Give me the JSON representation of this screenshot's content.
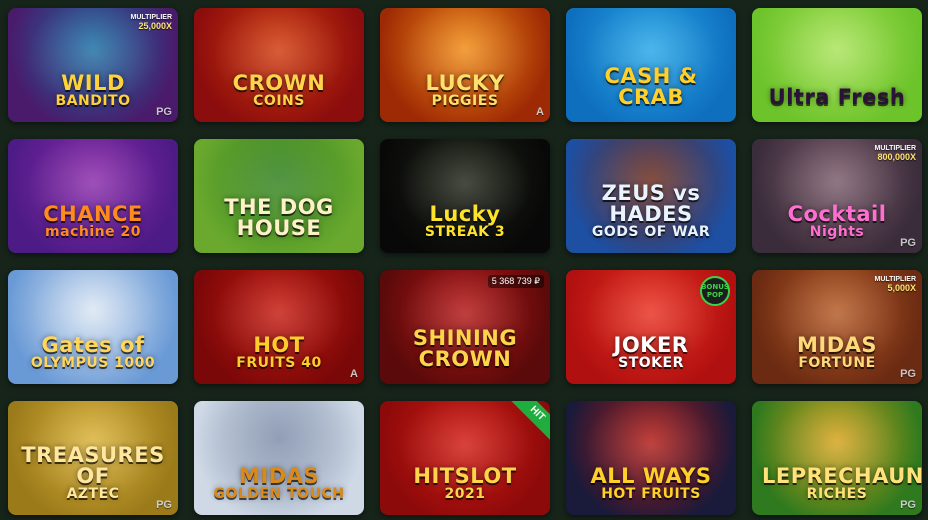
{
  "games": [
    {
      "id": "wild-bandito",
      "title": "WILD",
      "sub": "BANDITO",
      "provider": "PG",
      "multiplier": "MULTIPLIER",
      "mult_value": "25,000X",
      "colors": [
        "#4a1a6b",
        "#1a6fa3"
      ],
      "title_color": "#ffd23a"
    },
    {
      "id": "crown-coins",
      "title": "CROWN",
      "sub": "COINS",
      "provider": "",
      "colors": [
        "#8c0d0d",
        "#d03a0c"
      ],
      "title_color": "#ffd44a"
    },
    {
      "id": "lucky-piggies",
      "title": "LUCKY",
      "sub": "PIGGIES",
      "provider": "A",
      "colors": [
        "#9e2a05",
        "#f08a14"
      ],
      "title_color": "#ffe06a"
    },
    {
      "id": "cash-crab",
      "title": "CASH & CRAB",
      "sub": "",
      "provider": "",
      "colors": [
        "#0f6fbf",
        "#26a6e6"
      ],
      "title_color": "#ffcf2a"
    },
    {
      "id": "ultra-fresh",
      "title": "Ultra Fresh",
      "sub": "",
      "provider": "",
      "colors": [
        "#6cc32a",
        "#a9e25a"
      ],
      "title_color": "#2a1238"
    },
    {
      "id": "chance-machine",
      "title": "CHANCE",
      "sub": "machine 20",
      "provider": "",
      "colors": [
        "#4d1b86",
        "#8a2aa9"
      ],
      "title_color": "#ff8a1f"
    },
    {
      "id": "dog-house",
      "title": "THE DOG HOUSE",
      "sub": "",
      "provider": "",
      "colors": [
        "#6aa92e",
        "#2f7f1e"
      ],
      "title_color": "#fdf1c8"
    },
    {
      "id": "lucky-streak",
      "title": "Lucky",
      "sub": "STREAK 3",
      "provider": "",
      "colors": [
        "#080808",
        "#1f2417"
      ],
      "title_color": "#ffe32a"
    },
    {
      "id": "zeus-hades",
      "title": "ZEUS vs HADES",
      "sub": "GODS OF WAR",
      "provider": "",
      "colors": [
        "#1d4fa3",
        "#6b2b1b"
      ],
      "title_color": "#e9f4ff"
    },
    {
      "id": "cocktail-nights",
      "title": "Cocktail",
      "sub": "Nights",
      "provider": "PG",
      "multiplier": "MULTIPLIER",
      "mult_value": "800,000X",
      "colors": [
        "#3a2c3a",
        "#7a5a6a"
      ],
      "title_color": "#ff6fd1"
    },
    {
      "id": "gates-olympus",
      "title": "Gates of",
      "sub": "OLYMPUS 1000",
      "provider": "",
      "colors": [
        "#6a9ad6",
        "#dbe6f3"
      ],
      "title_color": "#ffd65a"
    },
    {
      "id": "hot-fruits-40",
      "title": "HOT",
      "sub": "FRUITS 40",
      "provider": "A",
      "colors": [
        "#7a0808",
        "#c41a10"
      ],
      "title_color": "#ffcc2a"
    },
    {
      "id": "shining-crown",
      "title": "SHINING CROWN",
      "sub": "",
      "provider": "",
      "counter": "5 368 739 ₽",
      "colors": [
        "#5a0a0a",
        "#b31515"
      ],
      "title_color": "#ffd34a"
    },
    {
      "id": "joker-stoker",
      "title": "JOKER",
      "sub": "STOKER",
      "provider": "",
      "bonus": "BONUS POP",
      "colors": [
        "#b01010",
        "#e83020"
      ],
      "title_color": "#ffffff"
    },
    {
      "id": "midas-fortune",
      "title": "MIDAS",
      "sub": "FORTUNE",
      "provider": "PG",
      "multiplier": "MULTIPLIER",
      "mult_value": "5,000X",
      "colors": [
        "#6b2a12",
        "#b45a25"
      ],
      "title_color": "#ffd87a"
    },
    {
      "id": "treasures-aztec",
      "title": "TREASURES OF",
      "sub": "AZTEC",
      "provider": "PG",
      "colors": [
        "#9b7a1a",
        "#d9b23a"
      ],
      "title_color": "#ffe7a0"
    },
    {
      "id": "midas-golden-touch",
      "title": "MIDAS",
      "sub": "GOLDEN TOUCH",
      "provider": "",
      "colors": [
        "#cfd9e6",
        "#7c8ca8"
      ],
      "title_color": "#d98a1a"
    },
    {
      "id": "hitslot",
      "title": "HITSLOT",
      "sub": "2021",
      "provider": "",
      "badge": "HIT",
      "colors": [
        "#8c0a0a",
        "#d01a12"
      ],
      "title_color": "#ffd34a"
    },
    {
      "id": "all-ways-hot-fruits",
      "title": "ALL WAYS",
      "sub": "HOT FRUITS",
      "provider": "",
      "colors": [
        "#1a1a3a",
        "#b21a14"
      ],
      "title_color": "#ffd02a"
    },
    {
      "id": "leprechaun-riches",
      "title": "LEPRECHAUN",
      "sub": "RICHES",
      "provider": "PG",
      "colors": [
        "#2f7a1e",
        "#d6a21a"
      ],
      "title_color": "#ffe27a"
    }
  ]
}
